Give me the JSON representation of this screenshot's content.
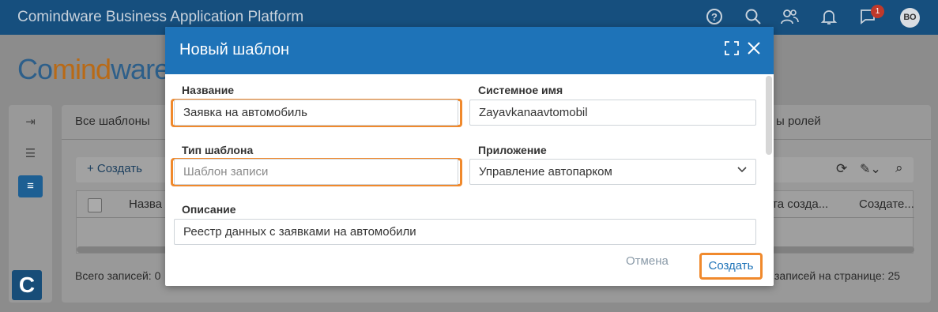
{
  "topbar": {
    "title": "Comindware Business Application Platform",
    "icons": [
      "help-icon",
      "search-icon",
      "users-icon",
      "bell-icon",
      "chat-icon"
    ],
    "chat_badge": "1",
    "avatar_initials": "ВО"
  },
  "background": {
    "logo_part1": "Co",
    "logo_part2": "mind",
    "logo_part3": "ware",
    "tab_all_templates": "Все шаблоны",
    "tab_roles": "ы ролей",
    "create_label": "+ Создать",
    "col_name": "Назва",
    "col_created": "та созда...",
    "col_creator": "Создате...",
    "total_records": "Всего записей: 0",
    "per_page": "записей на странице: 25"
  },
  "modal": {
    "title": "Новый шаблон",
    "name_label": "Название",
    "name_value": "Заявка на автомобиль",
    "sysname_label": "Системное имя",
    "sysname_value": "Zayavkanaavtomobil",
    "type_label": "Тип шаблона",
    "type_placeholder": "Шаблон записи",
    "app_label": "Приложение",
    "app_value": "Управление автопарком",
    "desc_label": "Описание",
    "desc_value": "Реестр данных с заявками на автомобили",
    "cancel_label": "Отмена",
    "create_label": "Создать"
  },
  "colors": {
    "topbar": "#164f7e",
    "modal_header": "#1e73b8",
    "highlight": "#f0892c"
  }
}
